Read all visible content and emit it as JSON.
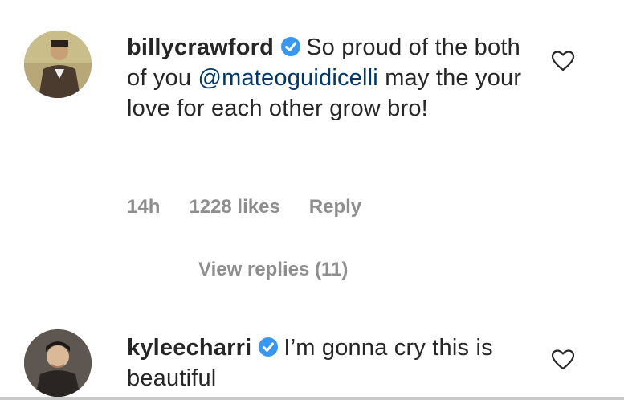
{
  "comments": [
    {
      "username": "billycrawford",
      "text_before_mention": "So proud of the both of you ",
      "mention": "@mateoguidicelli",
      "text_after_mention": " may the your love for each other grow bro!",
      "time": "14h",
      "likes": "1228 likes",
      "reply": "Reply",
      "view_replies": "View replies (11)"
    },
    {
      "username": "kyleecharri",
      "text": "I’m gonna cry this is beautiful"
    }
  ],
  "colors": {
    "verified": "#3897f0",
    "meta": "#8e8e8e",
    "mention": "#00376b"
  }
}
